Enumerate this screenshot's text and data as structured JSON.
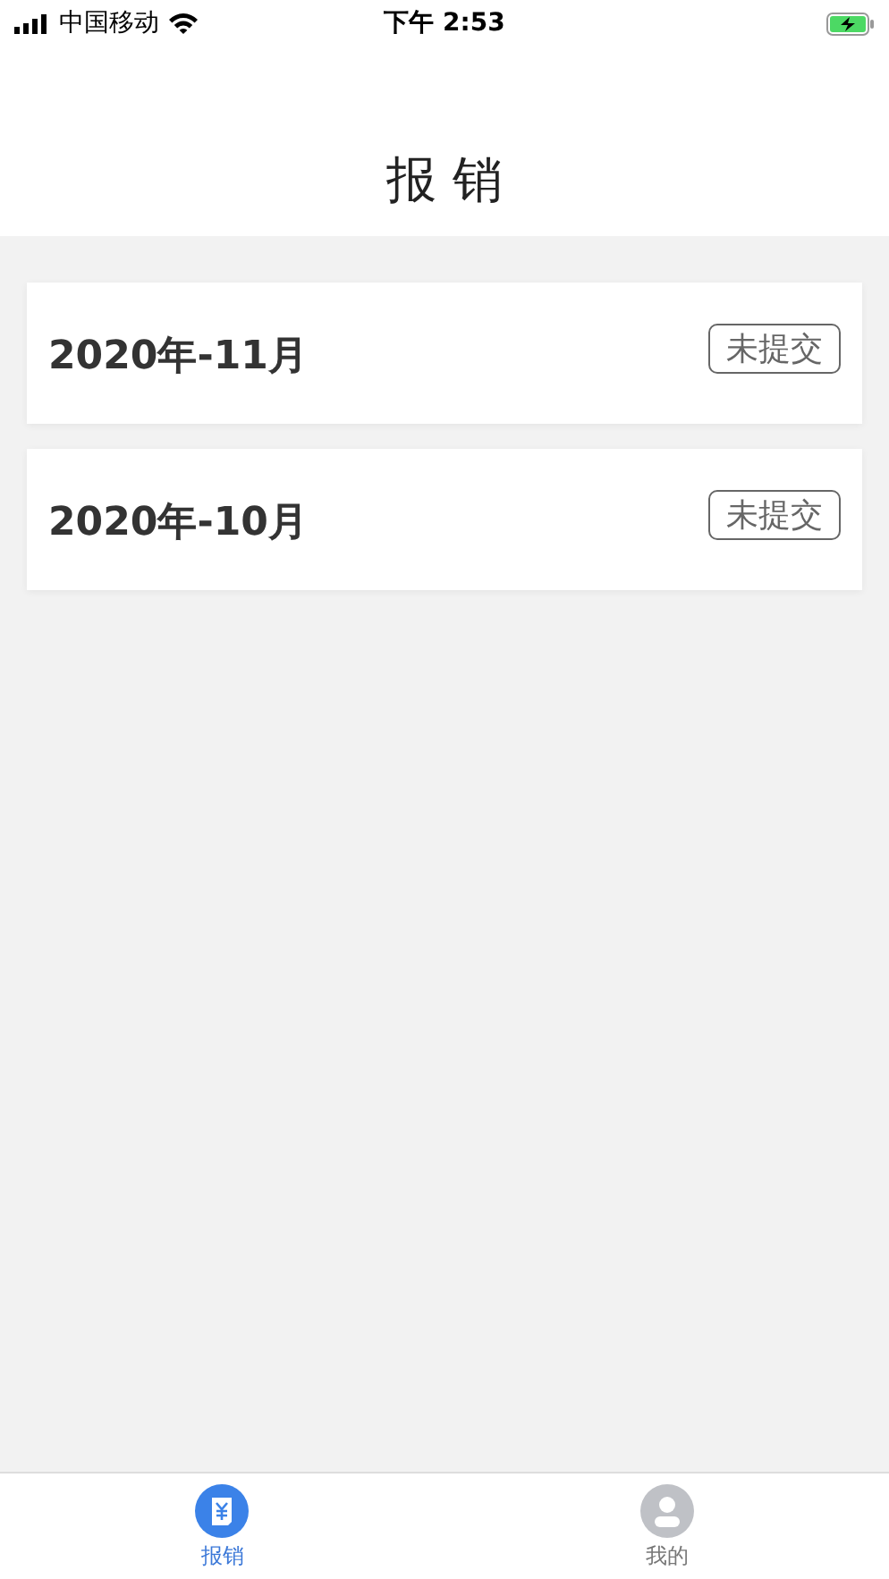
{
  "status_bar": {
    "carrier": "中国移动",
    "time": "下午 2:53"
  },
  "header": {
    "title": "报 销"
  },
  "records": [
    {
      "month": "2020年-11月",
      "status": "未提交"
    },
    {
      "month": "2020年-10月",
      "status": "未提交"
    }
  ],
  "tab_bar": [
    {
      "label": "报销",
      "kind": "receipt",
      "selected": true
    },
    {
      "label": "我的",
      "kind": "profile",
      "selected": false
    }
  ]
}
